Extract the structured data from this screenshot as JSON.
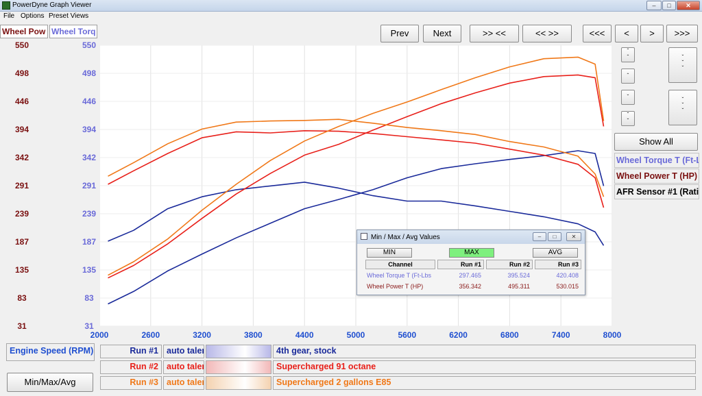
{
  "window": {
    "title": "PowerDyne Graph Viewer"
  },
  "menu": [
    "File",
    "Options",
    "Preset Views"
  ],
  "nav_buttons": {
    "prev": "Prev",
    "next": "Next",
    "zoom_in": ">> <<",
    "zoom_out": "<< >>",
    "first": "<<<",
    "left": "<",
    "right": ">",
    "last": ">>>"
  },
  "y_axes": {
    "power_tab": "Wheel Pow",
    "torque_tab": "Wheel Torq",
    "power_ticks": [
      "550",
      "498",
      "446",
      "394",
      "342",
      "291",
      "239",
      "187",
      "135",
      "83",
      "31"
    ],
    "torque_ticks": [
      "550",
      "498",
      "446",
      "394",
      "342",
      "291",
      "239",
      "187",
      "135",
      "83",
      "31"
    ]
  },
  "side_panel": {
    "show_all": "Show All",
    "channels": [
      "Wheel Torque T (Ft-L",
      "Wheel Power T (HP)",
      "AFR Sensor #1 (Rati"
    ]
  },
  "x_axis": {
    "label": "Engine Speed (RPM)",
    "ticks": [
      "2000",
      "2600",
      "3200",
      "3800",
      "4400",
      "5000",
      "5600",
      "6200",
      "6800",
      "7400",
      "8000"
    ]
  },
  "runs": [
    {
      "label": "Run #1",
      "user": "auto talen",
      "desc": "4th gear, stock",
      "color": "#1a2a9a",
      "blur": "#b8b8e8"
    },
    {
      "label": "Run #2",
      "user": "auto talen",
      "desc": "Supercharged 91 octane",
      "color": "#e8201a",
      "blur": "#f2b8b8"
    },
    {
      "label": "Run #3",
      "user": "auto talen",
      "desc": "Supercharged 2 gallons E85",
      "color": "#f07818",
      "blur": "#f4d2b0"
    }
  ],
  "minmax_button": "Min/Max/Avg",
  "popup": {
    "title": "Min / Max / Avg Values",
    "buttons": {
      "min": "MIN",
      "max": "MAX",
      "avg": "AVG"
    },
    "headers": [
      "Channel",
      "Run #1",
      "Run #2",
      "Run #3"
    ],
    "rows": [
      {
        "channel": "Wheel Torque T (Ft-Lbs",
        "values": [
          "297.465",
          "395.524",
          "420.408"
        ],
        "color": "#6a6ad8"
      },
      {
        "channel": "Wheel Power T (HP)",
        "values": [
          "356.342",
          "495.311",
          "530.015"
        ],
        "color": "#8a1a1a"
      }
    ]
  },
  "colors": {
    "power_axis": "#7a1010",
    "torque_axis": "#6a6ad8",
    "x_axis": "#1f4fd0",
    "max_active": "#7ef07e"
  },
  "chart_data": {
    "type": "line",
    "xlim": [
      2000,
      8000
    ],
    "ylim": [
      31,
      550
    ],
    "x": [
      2100,
      2400,
      2800,
      3200,
      3600,
      4000,
      4400,
      4800,
      5200,
      5600,
      6000,
      6400,
      6800,
      7200,
      7600,
      7800,
      7900
    ],
    "series": [
      {
        "name": "Run #1",
        "channel": "Wheel Torque T (Ft-L",
        "values": [
          188,
          208,
          248,
          270,
          283,
          290,
          297,
          286,
          272,
          262,
          262,
          253,
          243,
          233,
          220,
          205,
          180
        ]
      },
      {
        "name": "Run #1",
        "channel": "Wheel Power T (HP)",
        "values": [
          72,
          95,
          133,
          164,
          194,
          221,
          248,
          265,
          283,
          305,
          322,
          331,
          339,
          346,
          355,
          350,
          290
        ]
      },
      {
        "name": "Run #2",
        "channel": "Wheel Torque T (Ft-L",
        "values": [
          293,
          318,
          350,
          379,
          390,
          388,
          392,
          391,
          387,
          381,
          375,
          369,
          358,
          347,
          330,
          305,
          250
        ]
      },
      {
        "name": "Run #2",
        "channel": "Wheel Power T (HP)",
        "values": [
          120,
          143,
          183,
          230,
          275,
          313,
          347,
          367,
          393,
          418,
          442,
          462,
          480,
          492,
          495,
          490,
          400
        ]
      },
      {
        "name": "Run #3",
        "channel": "Wheel Torque T (Ft-L",
        "values": [
          308,
          333,
          368,
          395,
          408,
          410,
          411,
          413,
          406,
          398,
          392,
          385,
          372,
          362,
          345,
          312,
          270
        ]
      },
      {
        "name": "Run #3",
        "channel": "Wheel Power T (HP)",
        "values": [
          125,
          150,
          192,
          245,
          293,
          337,
          373,
          400,
          424,
          445,
          468,
          490,
          510,
          525,
          528,
          515,
          410
        ]
      }
    ]
  }
}
